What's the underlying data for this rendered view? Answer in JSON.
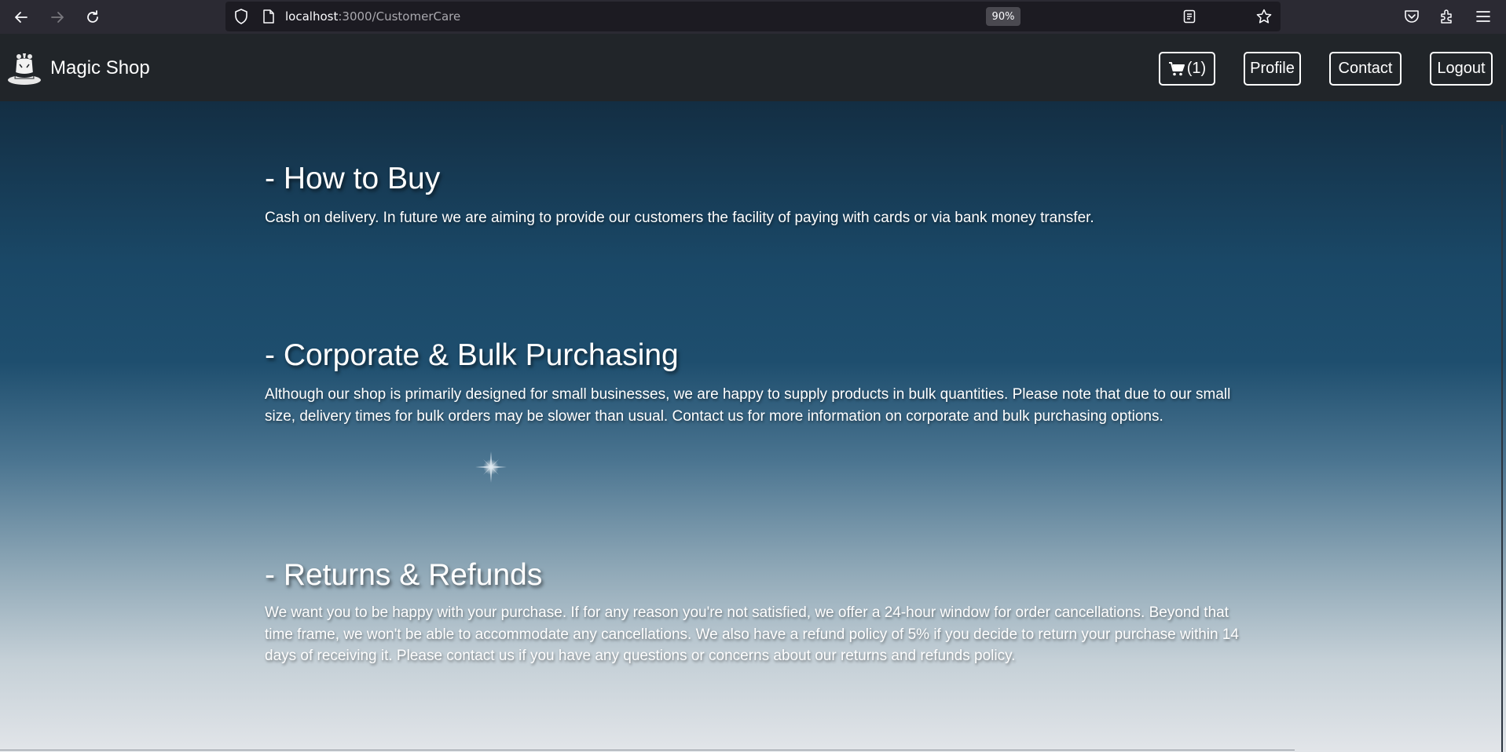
{
  "browser": {
    "url_host": "localhost",
    "url_path": ":3000/CustomerCare",
    "zoom": "90%",
    "icons": [
      "back-arrow-icon",
      "forward-arrow-icon",
      "reload-icon",
      "shield-icon",
      "page-icon",
      "reader-view-icon",
      "bookmark-star-icon",
      "pocket-icon",
      "extensions-icon",
      "menu-icon"
    ]
  },
  "header": {
    "brand": "Magic Shop",
    "cart_count": "(1)",
    "profile_label": "Profile",
    "contact_label": "Contact",
    "logout_label": "Logout"
  },
  "sections": [
    {
      "heading": "- How to Buy",
      "body": "Cash on delivery. In future we are aiming to provide our customers the facility of paying with cards or via bank money transfer."
    },
    {
      "heading": "- Corporate & Bulk Purchasing",
      "body": "Although our shop is primarily designed for small businesses, we are happy to supply products in bulk quantities. Please note that due to our small size, delivery times for bulk orders may be slower than usual. Contact us for more information on corporate and bulk purchasing options."
    },
    {
      "heading": "- Returns & Refunds",
      "body": "We want you to be happy with your purchase. If for any reason you're not satisfied, we offer a 24-hour window for order cancellations. Beyond that time frame, we won't be able to accommodate any cancellations. We also have a refund policy of 5% if you decide to return your purchase within 14 days of receiving it. Please contact us if you have any questions or concerns about our returns and refunds policy."
    }
  ],
  "colors": {
    "header_bg": "#212529",
    "browser_bg": "#2b2a33",
    "gradient_top": "#132e43",
    "gradient_bottom": "#e2e5e9"
  }
}
